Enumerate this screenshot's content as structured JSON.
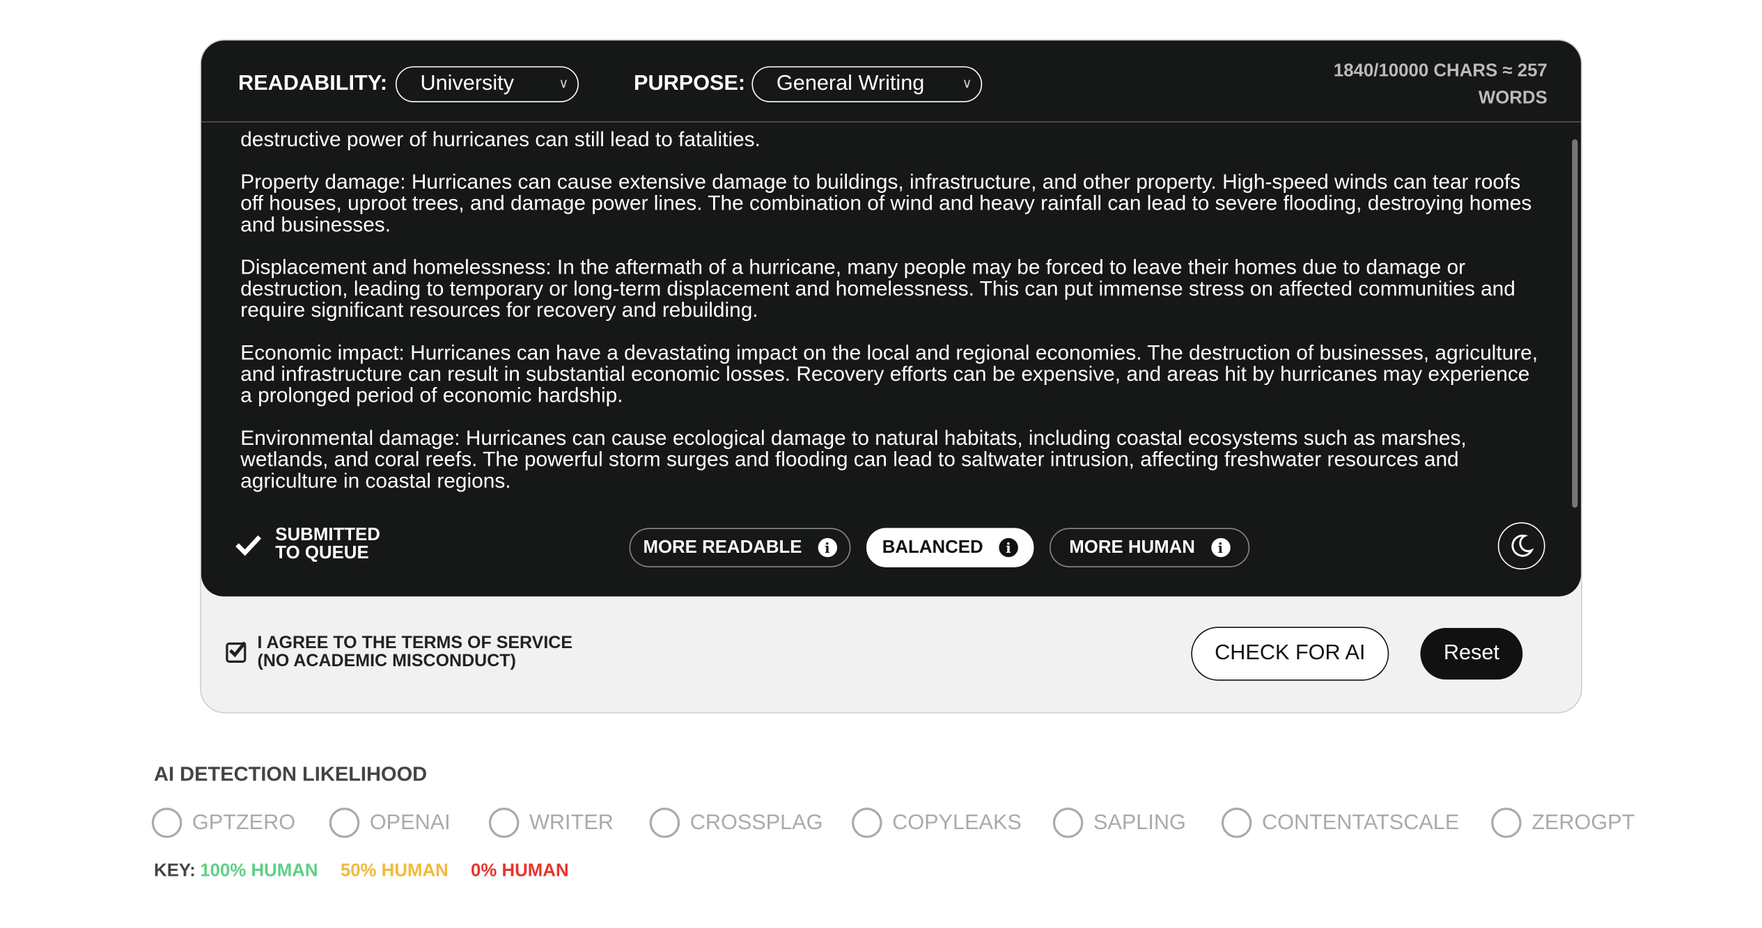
{
  "header": {
    "readability_label": "READABILITY:",
    "readability_value": "University",
    "purpose_label": "PURPOSE:",
    "purpose_value": "General Writing",
    "count_line1": "1840/10000 CHARS ≈ 257",
    "count_line2": "WORDS"
  },
  "text": {
    "paragraphs": [
      "destructive power of hurricanes can still lead to fatalities.",
      "Property damage: Hurricanes can cause extensive damage to buildings, infrastructure, and other property. High-speed winds can tear roofs off houses, uproot trees, and damage power lines. The combination of wind and heavy rainfall can lead to severe flooding, destroying homes and businesses.",
      "Displacement and homelessness: In the aftermath of a hurricane, many people may be forced to leave their homes due to damage or destruction, leading to temporary or long-term displacement and homelessness. This can put immense stress on affected communities and require significant resources for recovery and rebuilding.",
      "Economic impact: Hurricanes can have a devastating impact on the local and regional economies. The destruction of businesses, agriculture, and infrastructure can result in substantial economic losses. Recovery efforts can be expensive, and areas hit by hurricanes may experience a prolonged period of economic hardship.",
      "Environmental damage: Hurricanes can cause ecological damage to natural habitats, including coastal ecosystems such as marshes, wetlands, and coral reefs. The powerful storm surges and flooding can lead to saltwater intrusion, affecting freshwater resources and agriculture in coastal regions."
    ]
  },
  "status": {
    "line1": "SUBMITTED",
    "line2": "TO QUEUE"
  },
  "modes": [
    {
      "label": "MORE READABLE",
      "active": false
    },
    {
      "label": "BALANCED",
      "active": true
    },
    {
      "label": "MORE HUMAN",
      "active": false
    }
  ],
  "footer": {
    "agree_line1": "I AGREE TO THE TERMS OF SERVICE",
    "agree_line2": "(NO ACADEMIC MISCONDUCT)",
    "agree_checked": true,
    "check_label": "CHECK FOR AI",
    "reset_label": "Reset"
  },
  "detection": {
    "title": "AI DETECTION LIKELIHOOD",
    "detectors": [
      "GPTZERO",
      "OPENAI",
      "WRITER",
      "CROSSPLAG",
      "COPYLEAKS",
      "SAPLING",
      "CONTENTATSCALE",
      "ZEROGPT"
    ],
    "key_label": "KEY:",
    "key": [
      {
        "label": "100% HUMAN",
        "color": "#5fcf86"
      },
      {
        "label": "50% HUMAN",
        "color": "#f2b93b"
      },
      {
        "label": "0% HUMAN",
        "color": "#e8352a"
      }
    ]
  }
}
